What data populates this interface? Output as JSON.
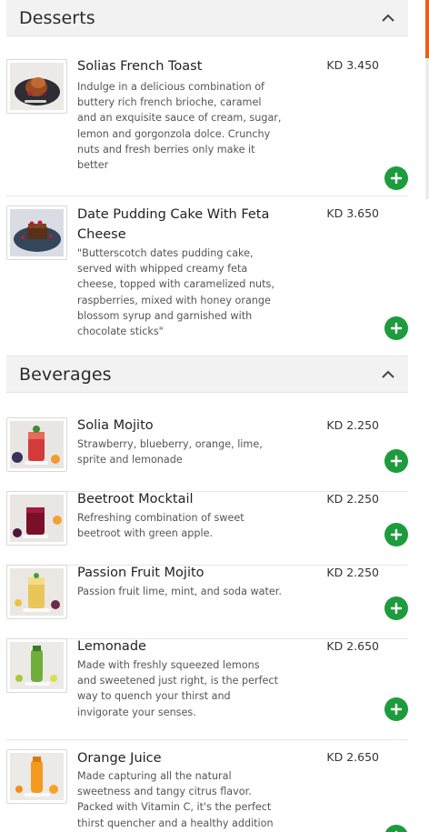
{
  "sections": [
    {
      "title": "Desserts",
      "items": [
        {
          "name": "Solias French Toast",
          "price": "KD 3.450",
          "description": "Indulge in a delicious combination of buttery rich french brioche, caramel and an exquisite sauce of cream, sugar, lemon and gorgonzola dolce. Crunchy nuts and fresh berries only make it better"
        },
        {
          "name_line1": "Date Pudding Cake With Feta",
          "name_line2": "Cheese",
          "price": "KD 3.650",
          "description": "\"Butterscotch dates pudding cake, served with whipped creamy feta cheese, topped with caramelized nuts, raspberries, mixed with honey orange blossom syrup and garnished with chocolate sticks\""
        }
      ]
    },
    {
      "title": "Beverages",
      "items": [
        {
          "name": "Solia Mojito",
          "price": "KD 2.250",
          "description": "Strawberry, blueberry, orange, lime, sprite and lemonade"
        },
        {
          "name": "Beetroot Mocktail",
          "price": "KD 2.250",
          "description": "Refreshing combination of sweet beetroot with green apple."
        },
        {
          "name": "Passion Fruit Mojito",
          "price": "KD 2.250",
          "description": "Passion fruit lime, mint, and soda water."
        },
        {
          "name": "Lemonade",
          "price": "KD 2.650",
          "description": "Made with freshly squeezed lemons and sweetened just right, is the perfect way to quench your thirst and invigorate your senses."
        },
        {
          "name": "Orange Juice",
          "price": "KD 2.650",
          "description": "Made capturing all the natural sweetness and tangy citrus flavor. Packed with Vitamin C, it's the perfect thirst quencher and a healthy addition to your daily diet."
        }
      ]
    }
  ],
  "icons": {
    "collapse": "chevron-up-icon",
    "add": "plus-icon"
  },
  "colors": {
    "add_button": "#1e9c3d",
    "accent": "#e35f1f",
    "header_bg": "#f2f2f2"
  }
}
